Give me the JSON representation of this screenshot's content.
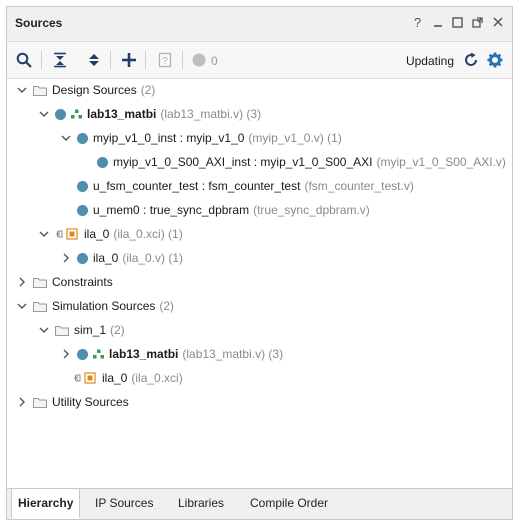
{
  "panel": {
    "title": "Sources",
    "controls": [
      "help-icon",
      "minimize-icon",
      "maximize-icon",
      "float-icon",
      "close-icon"
    ]
  },
  "toolbar": {
    "icons": [
      "search-icon",
      "collapse-all-icon",
      "expand-all-icon",
      "add-icon",
      "properties-icon",
      "status-circle-icon"
    ],
    "count": "0",
    "updating_label": "Updating",
    "accent": "#2d6fb4"
  },
  "tree": [
    {
      "label": "Design Sources",
      "suffix": "(2)"
    },
    {
      "label": "lab13_matbi",
      "suffix": "(lab13_matbi.v) (3)"
    },
    {
      "label": "myip_v1_0_inst : myip_v1_0",
      "suffix": "(myip_v1_0.v) (1)"
    },
    {
      "label": "myip_v1_0_S00_AXI_inst : myip_v1_0_S00_AXI",
      "suffix": "(myip_v1_0_S00_AXI.v)"
    },
    {
      "label": "u_fsm_counter_test : fsm_counter_test",
      "suffix": "(fsm_counter_test.v)"
    },
    {
      "label": "u_mem0 : true_sync_dpbram",
      "suffix": "(true_sync_dpbram.v)"
    },
    {
      "label": "ila_0",
      "suffix": "(ila_0.xci) (1)"
    },
    {
      "label": "ila_0",
      "suffix": "(ila_0.v) (1)"
    },
    {
      "label": "Constraints",
      "suffix": ""
    },
    {
      "label": "Simulation Sources",
      "suffix": "(2)"
    },
    {
      "label": "sim_1",
      "suffix": "(2)"
    },
    {
      "label": "lab13_matbi",
      "suffix": "(lab13_matbi.v) (3)"
    },
    {
      "label": "ila_0",
      "suffix": "(ila_0.xci)"
    },
    {
      "label": "Utility Sources",
      "suffix": ""
    }
  ],
  "tabs": [
    "Hierarchy",
    "IP Sources",
    "Libraries",
    "Compile Order"
  ],
  "colors": {
    "module_dot": "#4f8ea8",
    "hier_icon": "#3a9a4a",
    "ip_icon": "#e08a1e"
  }
}
